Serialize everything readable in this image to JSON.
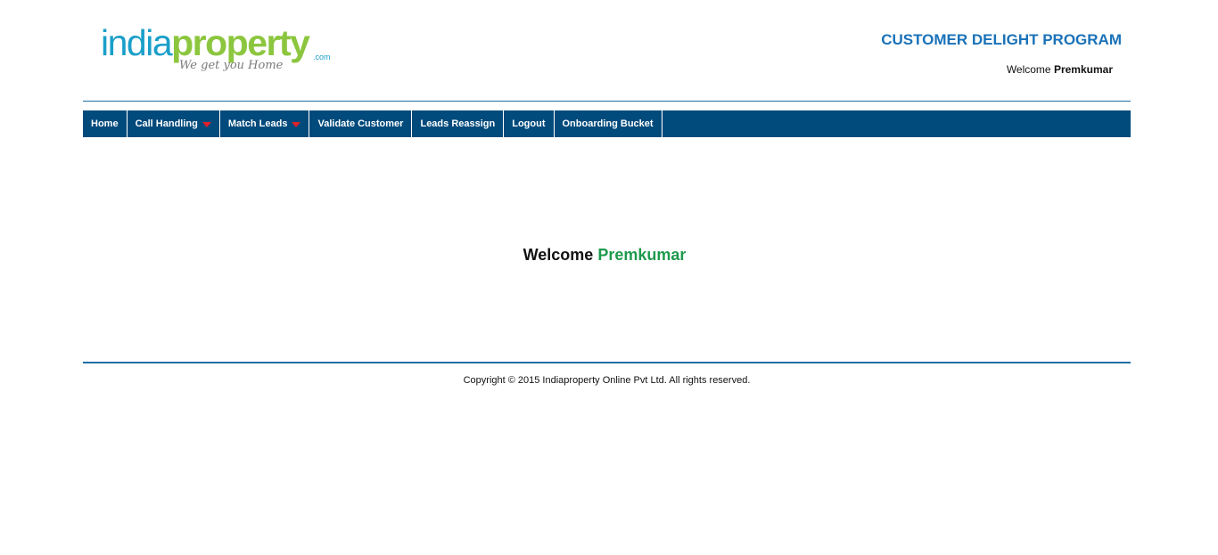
{
  "logo": {
    "india": "india",
    "property": "property",
    "dotcom": ".com",
    "tagline": "We get you Home"
  },
  "header": {
    "program_title": "CUSTOMER DELIGHT PROGRAM",
    "welcome_label": "Welcome",
    "user_name": "Premkumar"
  },
  "nav": {
    "items": [
      {
        "label": "Home"
      },
      {
        "label": "Call Handling"
      },
      {
        "label": "Match Leads"
      },
      {
        "label": "Validate Customer"
      },
      {
        "label": "Leads Reassign"
      },
      {
        "label": "Logout"
      },
      {
        "label": "Onboarding Bucket"
      }
    ]
  },
  "main": {
    "welcome_label": "Welcome",
    "user_name": "Premkumar"
  },
  "footer": {
    "copyright": "Copyright © 2015 Indiaproperty Online Pvt Ltd. All rights reserved."
  },
  "colors": {
    "nav_background": "#004a7c",
    "accent_blue": "#1a72b8",
    "user_green": "#1e9a4c",
    "dropdown_arrow": "#e0202a"
  }
}
